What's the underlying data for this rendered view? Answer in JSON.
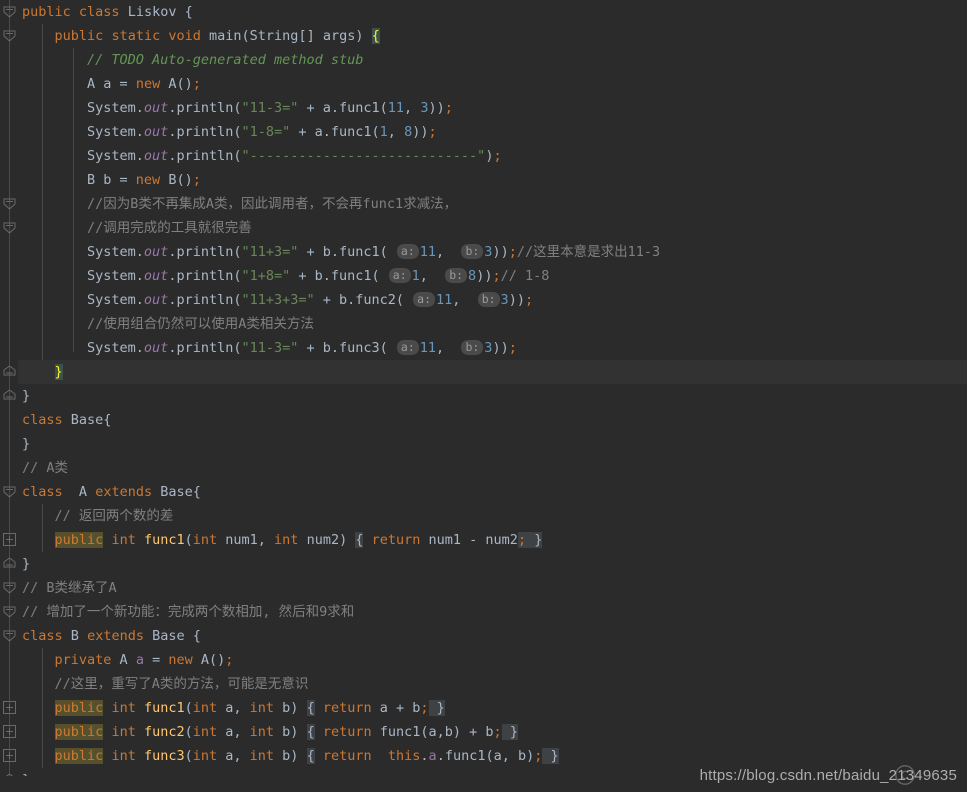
{
  "editor": {
    "language": "Java",
    "theme": "Darcula",
    "colors": {
      "background": "#2b2b2b",
      "current_line": "#323232",
      "foreground": "#a9b7c6",
      "keyword": "#cc7832",
      "string": "#6a8759",
      "number": "#6897bb",
      "comment": "#808080",
      "doc_comment": "#629755",
      "field": "#9876aa",
      "method": "#ffc66d",
      "search_highlight": "#56512c",
      "brace_match": "#3b514d",
      "brace_match_text": "#ffef28",
      "fold_region": "#3f4244",
      "inlay_hint_bg": "#4a4a4a",
      "inlay_hint_fg": "#9a9a9a",
      "gutter_rail": "#4b4b4b",
      "indent_guide": "#4a4a4a"
    },
    "watermark": "https://blog.csdn.net/baidu_21349635",
    "watermark_logo": "csdn-logo-icon"
  },
  "hints": {
    "a": "a:",
    "b": "b:"
  },
  "lines": [
    {
      "n": 1,
      "fold": "expanded",
      "indent": 0,
      "text": "public class Liskov {"
    },
    {
      "n": 2,
      "fold": "expanded",
      "indent": 1,
      "text": "public static void main(String[] args) {"
    },
    {
      "n": 3,
      "fold": "none",
      "indent": 2,
      "text": "// TODO Auto-generated method stub"
    },
    {
      "n": 4,
      "fold": "none",
      "indent": 2,
      "text": "A a = new A();"
    },
    {
      "n": 5,
      "fold": "none",
      "indent": 2,
      "text": "System.out.println(\"11-3=\" + a.func1(11, 3));"
    },
    {
      "n": 6,
      "fold": "none",
      "indent": 2,
      "text": "System.out.println(\"1-8=\" + a.func1(1, 8));"
    },
    {
      "n": 7,
      "fold": "none",
      "indent": 2,
      "text": "System.out.println(\"----------------------------\");"
    },
    {
      "n": 8,
      "fold": "none",
      "indent": 2,
      "text": "B b = new B();"
    },
    {
      "n": 9,
      "fold": "expanded",
      "indent": 2,
      "text": "//因为B类不再集成A类，因此调用者，不会再func1求减法，"
    },
    {
      "n": 10,
      "fold": "expanded",
      "indent": 2,
      "text": "//调用完成的工具就很完善"
    },
    {
      "n": 11,
      "fold": "none",
      "indent": 2,
      "text": "System.out.println(\"11+3=\" + b.func1( a: 11,  b: 3));//这里本意是求出11-3"
    },
    {
      "n": 12,
      "fold": "none",
      "indent": 2,
      "text": "System.out.println(\"1+8=\" + b.func1( a: 1,  b: 8));// 1-8"
    },
    {
      "n": 13,
      "fold": "none",
      "indent": 2,
      "text": "System.out.println(\"11+3+3=\" + b.func2( a: 11,  b: 3));"
    },
    {
      "n": 14,
      "fold": "none",
      "indent": 2,
      "text": "//使用组合仍然可以使用A类相关方法"
    },
    {
      "n": 15,
      "fold": "none",
      "indent": 2,
      "text": "System.out.println(\"11-3=\" + b.func3( a: 11,  b: 3));"
    },
    {
      "n": 16,
      "fold": "expanded",
      "indent": 1,
      "text": "}",
      "current": true
    },
    {
      "n": 17,
      "fold": "expanded",
      "indent": 0,
      "text": "}"
    },
    {
      "n": 18,
      "fold": "none",
      "indent": 0,
      "text": "class Base{"
    },
    {
      "n": 19,
      "fold": "none",
      "indent": 0,
      "text": "}"
    },
    {
      "n": 20,
      "fold": "none",
      "indent": 0,
      "text": "// A类"
    },
    {
      "n": 21,
      "fold": "expanded",
      "indent": 0,
      "text": "class  A extends Base{"
    },
    {
      "n": 22,
      "fold": "none",
      "indent": 1,
      "text": "// 返回两个数的差"
    },
    {
      "n": 23,
      "fold": "collapsed",
      "indent": 1,
      "text": "public int func1(int num1, int num2) { return num1 - num2; }"
    },
    {
      "n": 24,
      "fold": "expanded",
      "indent": 0,
      "text": "}"
    },
    {
      "n": 25,
      "fold": "expanded",
      "indent": 0,
      "text": "// B类继承了A"
    },
    {
      "n": 26,
      "fold": "expanded",
      "indent": 0,
      "text": "// 增加了一个新功能：完成两个数相加, 然后和9求和"
    },
    {
      "n": 27,
      "fold": "expanded",
      "indent": 0,
      "text": "class B extends Base {"
    },
    {
      "n": 28,
      "fold": "none",
      "indent": 1,
      "text": "private A a = new A();"
    },
    {
      "n": 29,
      "fold": "none",
      "indent": 1,
      "text": "//这里，重写了A类的方法，可能是无意识"
    },
    {
      "n": 30,
      "fold": "collapsed",
      "indent": 1,
      "text": "public int func1(int a, int b) { return a + b; }"
    },
    {
      "n": 31,
      "fold": "collapsed",
      "indent": 1,
      "text": "public int func2(int a, int b) { return func1(a,b) + b; }"
    },
    {
      "n": 32,
      "fold": "collapsed",
      "indent": 1,
      "text": "public int func3(int a, int b) { return  this.a.func1(a, b); }"
    },
    {
      "n": 33,
      "fold": "expanded",
      "indent": 0,
      "text": "}"
    }
  ],
  "strings": {
    "s_11_3": "\"11-3=\"",
    "s_1_8": "\"1-8=\"",
    "s_dashes": "\"----------------------------\"",
    "s_11p3": "\"11+3=\"",
    "s_1p8": "\"1+8=\"",
    "s_11p3p3": "\"11+3+3=\"",
    "s_11m3b": "\"11-3=\""
  },
  "comments": {
    "todo": "// TODO Auto-generated method stub",
    "cn_no_inherit": "//因为B类不再集成A类，因此调用者，不会再func1求减法，",
    "cn_tool_good": "//调用完成的工具就很完善",
    "cn_intent_11_3": "//这里本意是求出11-3",
    "cn_1_8": "// 1-8",
    "cn_composition": "//使用组合仍然可以使用A类相关方法",
    "cn_a_class": "// A类",
    "cn_return_diff": "// 返回两个数的差",
    "cn_b_extends_a": "// B类继承了A",
    "cn_new_feature": "// 增加了一个新功能：完成两个数相加, 然后和9求和",
    "cn_override": "//这里，重写了A类的方法，可能是无意识"
  }
}
